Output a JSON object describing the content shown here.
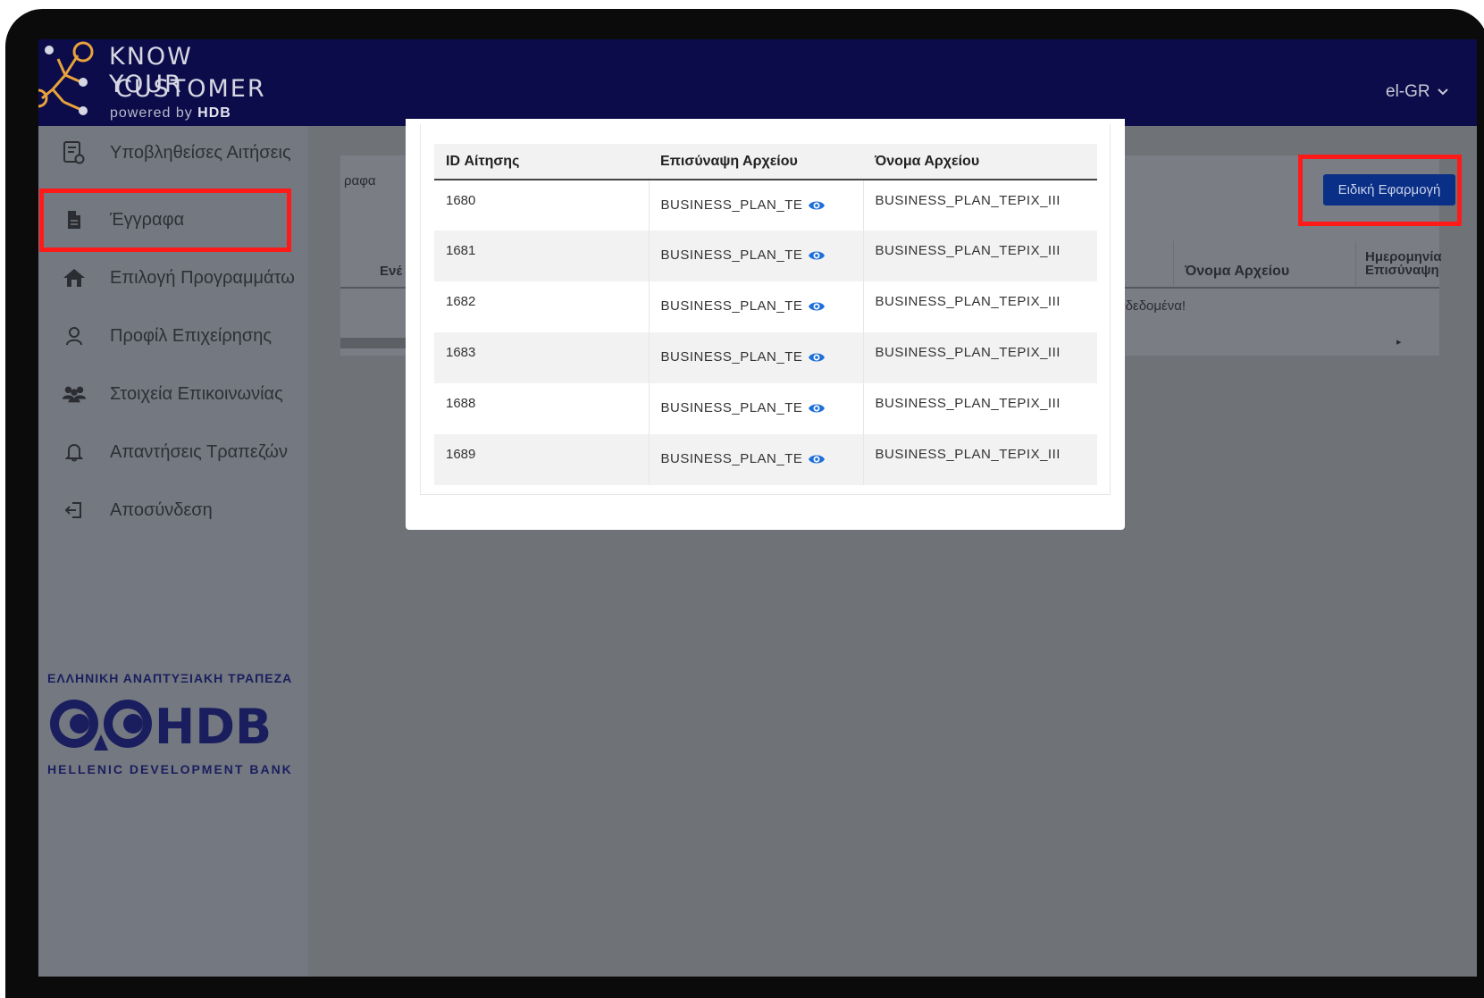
{
  "header": {
    "logo_line1": "KNOW YOUR",
    "logo_line2": "CUSTOMER",
    "logo_powered": "powered by",
    "logo_brand": "HDB",
    "language": "el-GR"
  },
  "sidebar": {
    "items": [
      {
        "label": "Υποβληθείσες Αιτήσεις",
        "icon": "document-list-icon"
      },
      {
        "label": "Έγγραφα",
        "icon": "file-icon"
      },
      {
        "label": "Επιλογή Προγραμμάτω",
        "icon": "home-icon"
      },
      {
        "label": "Προφίλ Επιχείρησης",
        "icon": "user-icon"
      },
      {
        "label": "Στοιχεία Επικοινωνίας",
        "icon": "group-icon"
      },
      {
        "label": "Απαντήσεις Τραπεζών",
        "icon": "bell-icon"
      },
      {
        "label": "Αποσύνδεση",
        "icon": "logout-icon"
      }
    ],
    "bank_title": "ΕΛΛΗΝΙΚΗ ΑΝΑΠΤΥΞΙΑΚΗ ΤΡΑΠΕΖΑ",
    "bank_logo_text": "HDB",
    "bank_subtitle": "HELLENIC DEVELOPMENT BANK"
  },
  "background": {
    "breadcrumb": "ραφα",
    "col_partial": "Ενέ",
    "col_file_name": "Όνομα Αρχείου",
    "col_date_line1": "Ημερομηνία",
    "col_date_line2": "Επισύναψη",
    "no_data": "ν δεδομένα!",
    "special_button": "Ειδική Εφαρμογή"
  },
  "modal": {
    "columns": [
      "ID Αίτησης",
      "Επισύναψη Αρχείου",
      "Όνομα Αρχείου"
    ],
    "rows": [
      {
        "id": "1680",
        "preview": "BUSINESS_PLAN_TEPIX_III",
        "name": "BUSINESS_PLAN_TEPIX_III"
      },
      {
        "id": "1681",
        "preview": "BUSINESS_PLAN_TEPIX_III",
        "name": "BUSINESS_PLAN_TEPIX_III"
      },
      {
        "id": "1682",
        "preview": "BUSINESS_PLAN_TEPIX_III",
        "name": "BUSINESS_PLAN_TEPIX_III"
      },
      {
        "id": "1683",
        "preview": "BUSINESS_PLAN_TEPIX_III",
        "name": "BUSINESS_PLAN_TEPIX_III"
      },
      {
        "id": "1688",
        "preview": "BUSINESS_PLAN_TEPIX_III",
        "name": "BUSINESS_PLAN_TEPIX_III"
      },
      {
        "id": "1689",
        "preview": "BUSINESS_PLAN_TEPIX_III",
        "name": "BUSINESS_PLAN_TEPIX_III"
      }
    ]
  },
  "colors": {
    "header_bg": "#0c0c4a",
    "highlight": "#ff1a1a",
    "primary_button": "#0a2f86",
    "eye_icon": "#1e6fd9"
  }
}
